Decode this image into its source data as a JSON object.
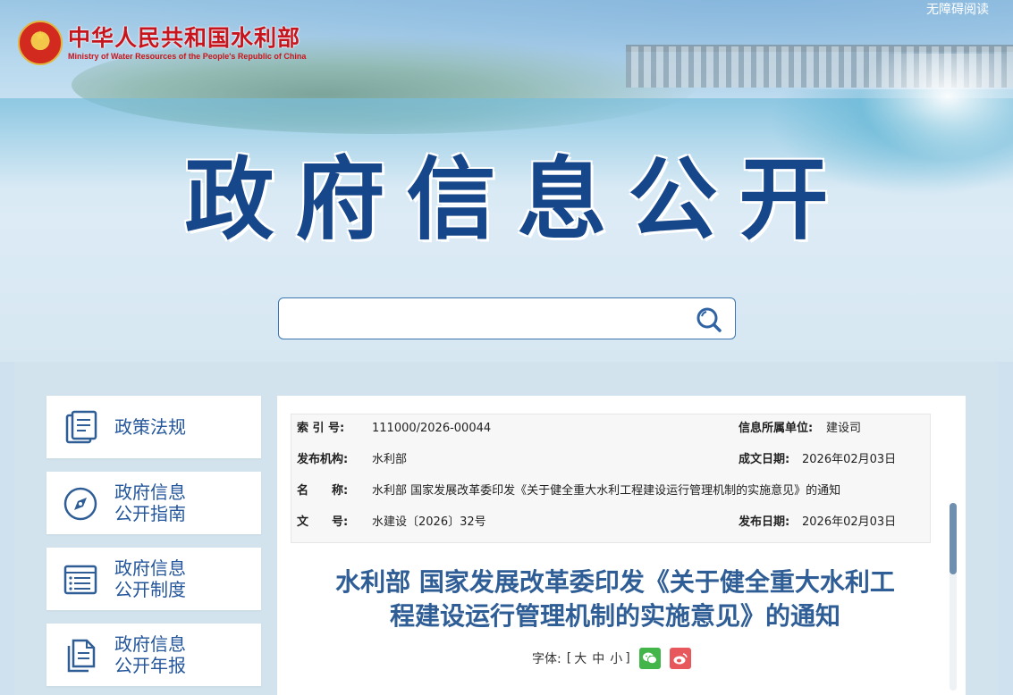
{
  "header": {
    "logo_cn": "中华人民共和国水利部",
    "logo_en": "Ministry of Water Resources of the People's Republic of China",
    "accessibility_link": "无障碍阅读",
    "page_title": "政府信息公开"
  },
  "search": {
    "value": "",
    "placeholder": "",
    "icon": "search-icon"
  },
  "sidebar": {
    "items": [
      {
        "label": "政策法规",
        "icon": "book-icon"
      },
      {
        "label": "政府信息公开指南",
        "line1": "政府信息",
        "line2": "公开指南",
        "icon": "compass-icon"
      },
      {
        "label": "政府信息公开制度",
        "line1": "政府信息",
        "line2": "公开制度",
        "icon": "list-icon"
      },
      {
        "label": "政府信息公开年报",
        "line1": "政府信息",
        "line2": "公开年报",
        "icon": "document-icon"
      }
    ]
  },
  "meta": {
    "index_label": "索 引 号:",
    "index_value": "111000/2026-00044",
    "unit_label": "信息所属单位:",
    "unit_value": "建设司",
    "publisher_label": "发布机构:",
    "publisher_value": "水利部",
    "date_label": "成文日期:",
    "date_value": "2026年02月03日",
    "name_label": "名　　称:",
    "name_value": "水利部 国家发展改革委印发《关于健全重大水利工程建设运行管理机制的实施意见》的通知",
    "docno_label": "文　　号:",
    "docno_value": "水建设〔2026〕32号",
    "pubdate_label": "发布日期:",
    "pubdate_value": "2026年02月03日"
  },
  "document": {
    "title_line1": "水利部 国家发展改革委印发《关于健全重大水利工",
    "title_line2": "程建设运行管理机制的实施意见》的通知",
    "font_label": "字体:",
    "font_open": "[",
    "font_large": "大",
    "font_medium": "中",
    "font_small": "小",
    "font_close": "]",
    "share_icons": [
      "wechat-icon",
      "weibo-icon"
    ]
  },
  "colors": {
    "title_blue": "#17478b",
    "nav_blue": "#24569b",
    "doc_title": "#2f5e96",
    "logo_red": "#c8151d"
  }
}
